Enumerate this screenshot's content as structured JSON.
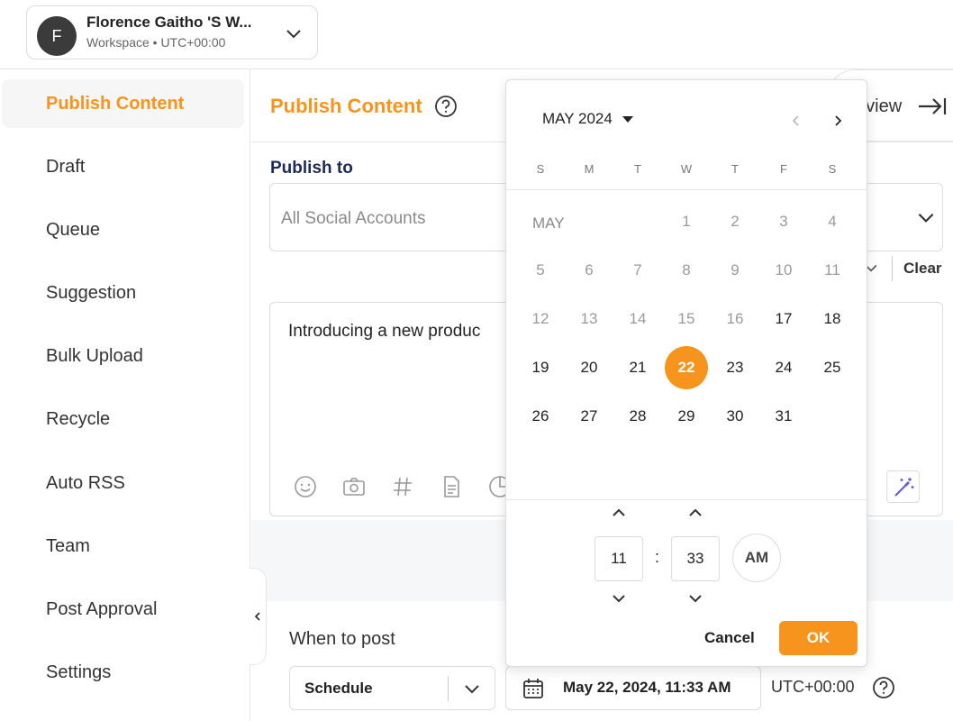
{
  "workspace": {
    "avatar_letter": "F",
    "name": "Florence Gaitho 'S W...",
    "subtitle": "Workspace • UTC+00:00"
  },
  "sidebar": {
    "items": [
      {
        "label": "Publish Content",
        "active": true
      },
      {
        "label": "Draft"
      },
      {
        "label": "Queue"
      },
      {
        "label": "Suggestion"
      },
      {
        "label": "Bulk Upload"
      },
      {
        "label": "Recycle"
      },
      {
        "label": "Auto RSS"
      },
      {
        "label": "Team"
      },
      {
        "label": "Post Approval"
      },
      {
        "label": "Settings"
      }
    ]
  },
  "header": {
    "title": "Publish Content",
    "preview_label": "eview"
  },
  "publish_to": {
    "label": "Publish to",
    "placeholder": "All Social Accounts",
    "clear_label": "Clear"
  },
  "editor": {
    "text": "Introducing a new produc"
  },
  "when_to_post": {
    "label": "When to post",
    "mode": "Schedule",
    "datetime": "May 22, 2024, 11:33 AM",
    "timezone": "UTC+00:00"
  },
  "date_picker": {
    "month_label": "MAY 2024",
    "weekdays": [
      "S",
      "M",
      "T",
      "W",
      "T",
      "F",
      "S"
    ],
    "month_tag": "MAY",
    "selected_day": 22,
    "first_enabled_day": 17,
    "hour": "11",
    "minute": "33",
    "period": "AM",
    "cancel_label": "Cancel",
    "ok_label": "OK"
  },
  "colors": {
    "accent": "#f7941d",
    "publish_to_label": "#1e2a5a"
  }
}
